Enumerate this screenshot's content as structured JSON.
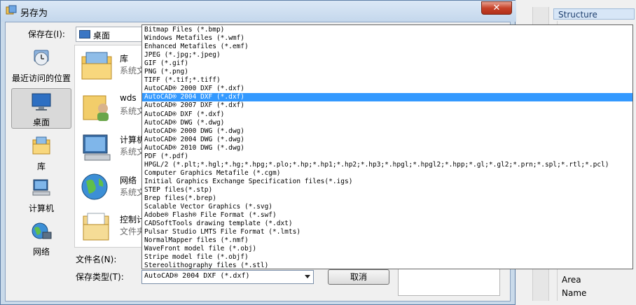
{
  "dialog": {
    "title": "另存为",
    "close_label": "✕",
    "save_in_label": "保存在(I):",
    "save_in_value": "桌面",
    "file_name_label": "文件名(N):",
    "file_type_label": "保存类型(T):",
    "file_type_value": "AutoCAD® 2004 DXF (*.dxf)",
    "cancel_label": "取消"
  },
  "places": [
    {
      "label": "最近访问的位置",
      "icon": "recent-places-icon"
    },
    {
      "label": "桌面",
      "icon": "desktop-icon",
      "selected": true
    },
    {
      "label": "库",
      "icon": "libraries-icon"
    },
    {
      "label": "计算机",
      "icon": "computer-icon"
    },
    {
      "label": "网络",
      "icon": "network-icon"
    }
  ],
  "files": [
    {
      "name": "库",
      "type": "系统文",
      "icon": "libraries-icon"
    },
    {
      "name": "wds",
      "type": "系统文",
      "icon": "user-folder-icon"
    },
    {
      "name": "计算机",
      "type": "系统文",
      "icon": "computer-icon"
    },
    {
      "name": "网络",
      "type": "系统文",
      "icon": "network-icon"
    },
    {
      "name": "控制计",
      "type": "文件夹",
      "icon": "control-panel-icon"
    }
  ],
  "file_types": [
    "Bitmap Files (*.bmp)",
    "Windows Metafiles (*.wmf)",
    "Enhanced Metafiles (*.emf)",
    "JPEG (*.jpg;*.jpeg)",
    "GIF (*.gif)",
    "PNG (*.png)",
    "TIFF (*.tif;*.tiff)",
    "AutoCAD® 2000 DXF (*.dxf)",
    "AutoCAD® 2004 DXF (*.dxf)",
    "AutoCAD® 2007 DXF (*.dxf)",
    "AutoCAD® DXF (*.dxf)",
    "AutoCAD® DWG (*.dwg)",
    "AutoCAD® 2000 DWG (*.dwg)",
    "AutoCAD® 2004 DWG (*.dwg)",
    "AutoCAD® 2010 DWG (*.dwg)",
    "PDF (*.pdf)",
    "HPGL/2 (*.plt;*.hgl;*.hg;*.hpg;*.plo;*.hp;*.hp1;*.hp2;*.hp3;*.hpgl;*.hpgl2;*.hpp;*.gl;*.gl2;*.prn;*.spl;*.rtl;*.pcl)",
    "Computer Graphics Metafile (*.cgm)",
    "Initial Graphics Exchange Specification files(*.igs)",
    "STEP files(*.stp)",
    "Brep files(*.brep)",
    "Scalable Vector Graphics (*.svg)",
    "Adobe® Flash® File Format (*.swf)",
    "CADSoftTools drawing template (*.dxt)",
    "Pulsar Studio LMTS File Format (*.lmts)",
    "NormalMapper files (*.nmf)",
    "WaveFront model file (*.obj)",
    "Stripe model file (*.objf)",
    "Stereolithography files (*.stl)"
  ],
  "selected_file_type_index": 8,
  "background": {
    "structure_label": "Structure",
    "items": [
      "Area",
      "Name"
    ]
  }
}
